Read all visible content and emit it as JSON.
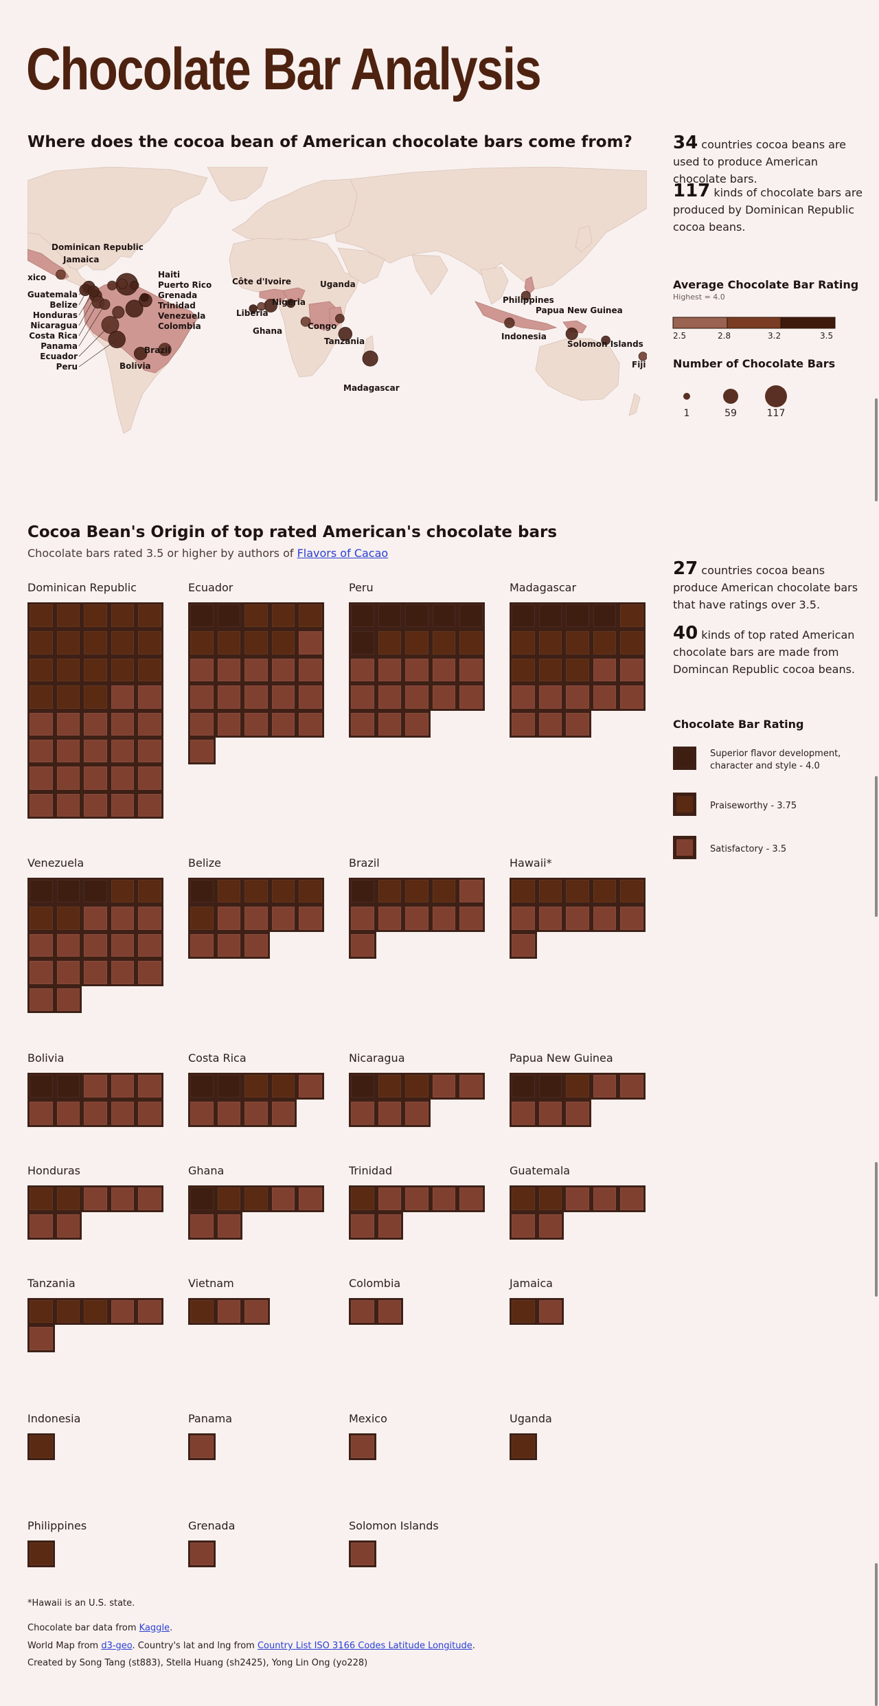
{
  "page": {
    "title": "Chocolate Bar Analysis",
    "map_title": "Where does the cocoa bean of American chocolate bars come from?",
    "grid_title": "Cocoa Bean's Origin of top rated American's chocolate bars",
    "grid_subtitle_prefix": "Chocolate bars rated 3.5 or higher by authors of ",
    "grid_subtitle_link": "Flavors of Cacao"
  },
  "map_stats": [
    {
      "num": "34",
      "text": " countries cocoa beans are used to produce American chocolate bars."
    },
    {
      "num": "117",
      "text": " kinds of chocolate bars are produced by Dominican Republic cocoa beans."
    }
  ],
  "grid_stats": [
    {
      "num": "27",
      "text": " countries cocoa beans produce American chocolate bars that have ratings over 3.5."
    },
    {
      "num": "40",
      "text": " kinds of top rated American chocolate bars are made from Domincan Republic cocoa beans."
    }
  ],
  "legend": {
    "avg_rating_title": "Average Chocolate Bar Rating",
    "avg_rating_sub": "Highest = 4.0",
    "scale_ticks": [
      "2.5",
      "2.8",
      "3.2",
      "3.5"
    ],
    "scale_colors": [
      "#9a6250",
      "#7a3c22",
      "#5a2812",
      "#3e1a0c"
    ],
    "count_title": "Number of Chocolate Bars",
    "count_labels": [
      "1",
      "59",
      "117"
    ]
  },
  "rating_legend": {
    "title": "Chocolate Bar Rating",
    "items": [
      {
        "label": "Superior flavor development, character and style - 4.0",
        "color": "#3f1e12"
      },
      {
        "label": "Praiseworthy - 3.75",
        "color": "#5a2a12"
      },
      {
        "label": "Satisfactory - 3.5",
        "color": "#804030"
      }
    ]
  },
  "colors": {
    "bar_frame": "#3e2016",
    "rating_4_0": "#3f1e12",
    "rating_3_75": "#5a2a12",
    "rating_3_5": "#804030",
    "map_land": "#eedbd0",
    "map_highlight": "#cf9792"
  },
  "chart_data": [
    {
      "type": "scatter",
      "title": "Where does the cocoa bean of American chocolate bars come from?",
      "encoding": "bubble map: size = number of chocolate bars, color = average rating",
      "points": [
        {
          "label": "Dominican Republic",
          "lon": -70.2,
          "lat": 18.7,
          "count": 117,
          "rating": 3.3
        },
        {
          "label": "Jamaica",
          "lon": -77.3,
          "lat": 18.1,
          "count": 6,
          "rating": 3.2
        },
        {
          "label": "Mexico",
          "lon": -102.0,
          "lat": 23.6,
          "count": 7,
          "rating": 2.9
        },
        {
          "label": "Haiti",
          "lon": -72.3,
          "lat": 19.0,
          "count": 8,
          "rating": 3.2
        },
        {
          "label": "Puerto Rico",
          "lon": -66.5,
          "lat": 18.2,
          "count": 4,
          "rating": 3.3
        },
        {
          "label": "Grenada",
          "lon": -61.7,
          "lat": 12.1,
          "count": 3,
          "rating": 3.5
        },
        {
          "label": "Trinidad",
          "lon": -61.2,
          "lat": 10.6,
          "count": 25,
          "rating": 3.4
        },
        {
          "label": "Venezuela",
          "lon": -66.6,
          "lat": 6.4,
          "count": 60,
          "rating": 3.3
        },
        {
          "label": "Colombia",
          "lon": -74.3,
          "lat": 4.6,
          "count": 18,
          "rating": 3.2
        },
        {
          "label": "Guatemala",
          "lon": -90.2,
          "lat": 15.8,
          "count": 16,
          "rating": 3.4
        },
        {
          "label": "Belize",
          "lon": -88.5,
          "lat": 17.2,
          "count": 20,
          "rating": 3.4
        },
        {
          "label": "Honduras",
          "lon": -86.2,
          "lat": 15.2,
          "count": 13,
          "rating": 3.4
        },
        {
          "label": "Nicaragua",
          "lon": -85.2,
          "lat": 12.9,
          "count": 20,
          "rating": 3.4
        },
        {
          "label": "Costa Rica",
          "lon": -84.0,
          "lat": 9.7,
          "count": 20,
          "rating": 3.2
        },
        {
          "label": "Panama",
          "lon": -80.8,
          "lat": 8.5,
          "count": 10,
          "rating": 3.2
        },
        {
          "label": "Ecuador",
          "lon": -78.2,
          "lat": -1.8,
          "count": 60,
          "rating": 3.2
        },
        {
          "label": "Peru",
          "lon": -75.0,
          "lat": -9.2,
          "count": 57,
          "rating": 3.3
        },
        {
          "label": "Brazil",
          "lon": -51.9,
          "lat": -14.2,
          "count": 22,
          "rating": 3.2
        },
        {
          "label": "Bolivia",
          "lon": -63.6,
          "lat": -16.3,
          "count": 24,
          "rating": 3.3
        },
        {
          "label": "Côte d'Ivoire",
          "lon": -5.5,
          "lat": 7.5,
          "count": 3,
          "rating": 3.0
        },
        {
          "label": "Liberia",
          "lon": -9.4,
          "lat": 6.4,
          "count": 3,
          "rating": 3.5
        },
        {
          "label": "Ghana",
          "lon": -1.0,
          "lat": 7.9,
          "count": 25,
          "rating": 3.3
        },
        {
          "label": "Nigeria",
          "lon": 8.7,
          "lat": 9.1,
          "count": 4,
          "rating": 3.6
        },
        {
          "label": "Uganda",
          "lon": 32.3,
          "lat": 1.4,
          "count": 5,
          "rating": 3.1
        },
        {
          "label": "Congo",
          "lon": 15.8,
          "lat": -0.2,
          "count": 7,
          "rating": 3.0
        },
        {
          "label": "Tanzania",
          "lon": 34.9,
          "lat": -6.4,
          "count": 28,
          "rating": 3.4
        },
        {
          "label": "Madagascar",
          "lon": 46.9,
          "lat": -18.8,
          "count": 42,
          "rating": 3.3
        },
        {
          "label": "Philippines",
          "lon": 121.8,
          "lat": 12.9,
          "count": 6,
          "rating": 3.2
        },
        {
          "label": "Papua New Guinea",
          "lon": 143.9,
          "lat": -6.3,
          "count": 18,
          "rating": 3.4
        },
        {
          "label": "Indonesia",
          "lon": 113.9,
          "lat": -0.8,
          "count": 9,
          "rating": 3.1
        },
        {
          "label": "Solomon Islands",
          "lon": 160.2,
          "lat": -9.6,
          "count": 5,
          "rating": 3.3
        },
        {
          "label": "Fiji",
          "lon": 178.1,
          "lat": -17.7,
          "count": 4,
          "rating": 3.0
        }
      ]
    },
    {
      "type": "table",
      "title": "Cocoa Bean's Origin of top rated American's chocolate bars",
      "columns_per_bar_row": 5,
      "countries": [
        {
          "name": "Dominican Republic",
          "counts": {
            "4": 0,
            "3.75": 18,
            "3.5": 22
          }
        },
        {
          "name": "Ecuador",
          "counts": {
            "4": 2,
            "3.75": 7,
            "3.5": 17
          }
        },
        {
          "name": "Peru",
          "counts": {
            "4": 6,
            "3.75": 4,
            "3.5": 13
          }
        },
        {
          "name": "Madagascar",
          "counts": {
            "4": 4,
            "3.75": 9,
            "3.5": 10
          }
        },
        {
          "name": "Venezuela",
          "counts": {
            "4": 3,
            "3.75": 4,
            "3.5": 15
          }
        },
        {
          "name": "Belize",
          "counts": {
            "4": 1,
            "3.75": 5,
            "3.5": 7
          }
        },
        {
          "name": "Brazil",
          "counts": {
            "4": 1,
            "3.75": 3,
            "3.5": 7
          }
        },
        {
          "name": "Hawaii*",
          "counts": {
            "4": 0,
            "3.75": 5,
            "3.5": 6
          }
        },
        {
          "name": "Bolivia",
          "counts": {
            "4": 2,
            "3.75": 0,
            "3.5": 8
          }
        },
        {
          "name": "Costa Rica",
          "counts": {
            "4": 2,
            "3.75": 2,
            "3.5": 5
          }
        },
        {
          "name": "Nicaragua",
          "counts": {
            "4": 1,
            "3.75": 2,
            "3.5": 5
          }
        },
        {
          "name": "Papua New Guinea",
          "counts": {
            "4": 2,
            "3.75": 1,
            "3.5": 5
          }
        },
        {
          "name": "Honduras",
          "counts": {
            "4": 0,
            "3.75": 2,
            "3.5": 5
          }
        },
        {
          "name": "Ghana",
          "counts": {
            "4": 1,
            "3.75": 2,
            "3.5": 4
          }
        },
        {
          "name": "Trinidad",
          "counts": {
            "4": 0,
            "3.75": 1,
            "3.5": 6
          }
        },
        {
          "name": "Guatemala",
          "counts": {
            "4": 0,
            "3.75": 2,
            "3.5": 5
          }
        },
        {
          "name": "Tanzania",
          "counts": {
            "4": 0,
            "3.75": 3,
            "3.5": 3
          }
        },
        {
          "name": "Vietnam",
          "counts": {
            "4": 0,
            "3.75": 1,
            "3.5": 2
          }
        },
        {
          "name": "Colombia",
          "counts": {
            "4": 0,
            "3.75": 0,
            "3.5": 2
          }
        },
        {
          "name": "Jamaica",
          "counts": {
            "4": 0,
            "3.75": 1,
            "3.5": 1
          }
        },
        {
          "name": "Indonesia",
          "counts": {
            "4": 0,
            "3.75": 1,
            "3.5": 0
          }
        },
        {
          "name": "Panama",
          "counts": {
            "4": 0,
            "3.75": 0,
            "3.5": 1
          }
        },
        {
          "name": "Mexico",
          "counts": {
            "4": 0,
            "3.75": 0,
            "3.5": 1
          }
        },
        {
          "name": "Uganda",
          "counts": {
            "4": 0,
            "3.75": 1,
            "3.5": 0
          }
        },
        {
          "name": "Philippines",
          "counts": {
            "4": 0,
            "3.75": 1,
            "3.5": 0
          }
        },
        {
          "name": "Grenada",
          "counts": {
            "4": 0,
            "3.75": 0,
            "3.5": 1
          }
        },
        {
          "name": "Solomon Islands",
          "counts": {
            "4": 0,
            "3.75": 0,
            "3.5": 1
          }
        }
      ]
    }
  ],
  "footer": {
    "note": "*Hawaii is an U.S. state.",
    "data_prefix": "Chocolate bar data from ",
    "data_link": "Kaggle",
    "data_suffix": ".",
    "map_prefix": "World Map from ",
    "map_link": "d3-geo",
    "map_mid": ". Country's lat and lng from ",
    "map_link2": "Country List ISO 3166 Codes Latitude Longitude",
    "map_suffix": ".",
    "credits": "Created by Song Tang (st883), Stella Huang (sh2425), Yong Lin Ong (yo228)"
  }
}
